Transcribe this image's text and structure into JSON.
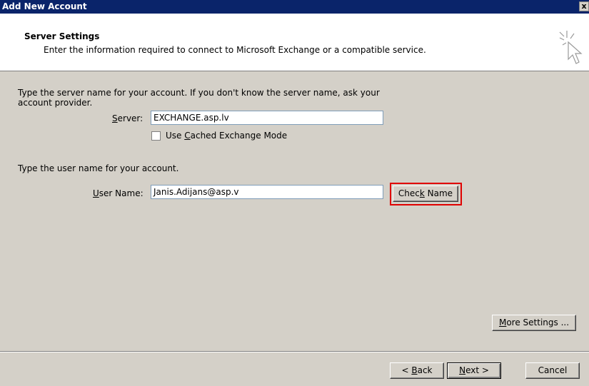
{
  "window": {
    "title": "Add New Account",
    "close_label": "x"
  },
  "header": {
    "title": "Server Settings",
    "subtitle": "Enter the information required to connect to Microsoft Exchange or a compatible service.",
    "icon": "cursor-sparkle-icon"
  },
  "server_section": {
    "instructions_line1": "Type the server name for your account. If you don't know the server name, ask your",
    "instructions_line2": "account provider.",
    "server_label_prefix": "",
    "server_label_mnemonic": "S",
    "server_label_suffix": "erver:",
    "server_value": "EXCHANGE.asp.lv",
    "cached_mode_prefix": "Use ",
    "cached_mode_mnemonic": "C",
    "cached_mode_suffix": "ached Exchange Mode",
    "cached_mode_checked": false
  },
  "user_section": {
    "instructions": "Type the user name for your account.",
    "user_label_mnemonic": "U",
    "user_label_suffix": "ser Name:",
    "user_value": "Janis.Adijans@asp.v",
    "check_name_prefix": "Chec",
    "check_name_mnemonic": "k",
    "check_name_suffix": " Name"
  },
  "more_settings": {
    "mnemonic": "M",
    "suffix": "ore Settings ..."
  },
  "footer": {
    "back_prefix": "< ",
    "back_mnemonic": "B",
    "back_suffix": "ack",
    "next_mnemonic": "N",
    "next_suffix": "ext >",
    "cancel_label": "Cancel"
  },
  "colors": {
    "title_bar": "#0a246a",
    "dialog_bg": "#d4d0c8",
    "highlight": "#e00000"
  }
}
